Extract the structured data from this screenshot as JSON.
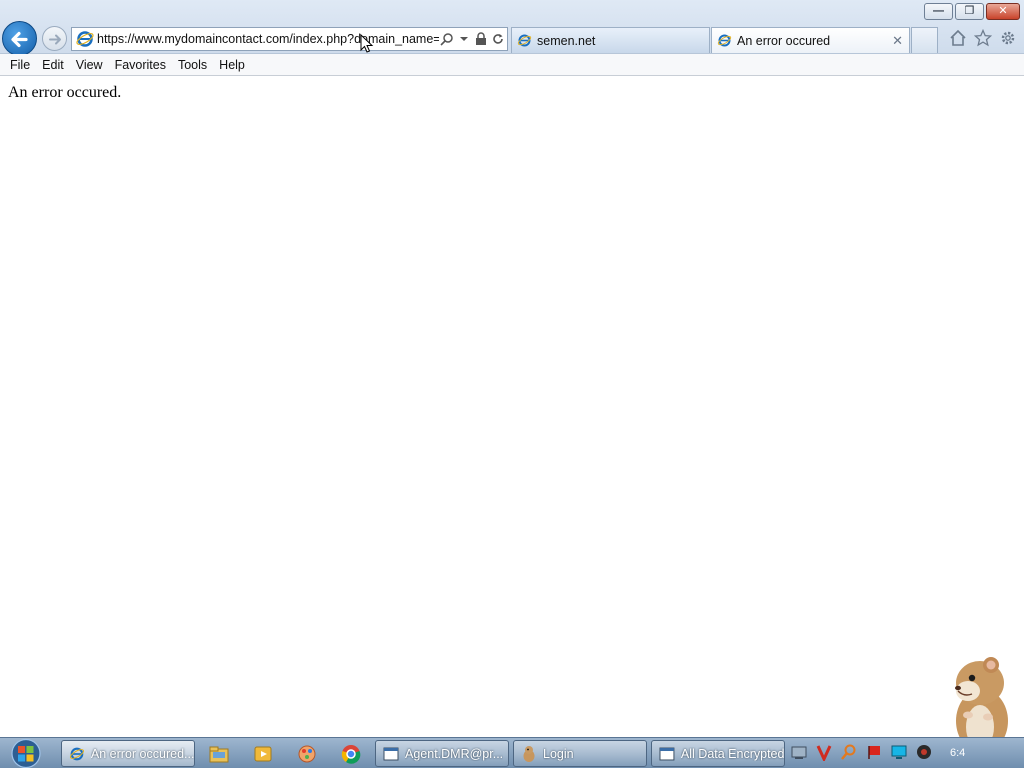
{
  "window": {
    "minimize_glyph": "—",
    "restore_glyph": "❐",
    "close_glyph": "✕"
  },
  "address_bar": {
    "url": "https://www.mydomaincontact.com/index.php?domain_name="
  },
  "tabs": [
    {
      "label": "semen.net",
      "icon": "ie-icon",
      "active": false
    },
    {
      "label": "An error occured",
      "icon": "ie-icon",
      "active": true,
      "close_glyph": "✕"
    }
  ],
  "menu": {
    "items": [
      "File",
      "Edit",
      "View",
      "Favorites",
      "Tools",
      "Help"
    ]
  },
  "page": {
    "message": "An error occured."
  },
  "taskbar": {
    "buttons": [
      {
        "label": "An error occured...",
        "icon": "ie-icon"
      },
      {
        "label": "Agent.DMR@pr...",
        "icon": "window-icon"
      },
      {
        "label": "Login",
        "icon": "hamster-icon"
      },
      {
        "label": "All Data Encrypted",
        "icon": "window-icon"
      }
    ],
    "pinned": [
      "explorer-icon",
      "media-player-icon",
      "paint-icon",
      "chrome-icon"
    ],
    "tray": [
      "network-icon",
      "v-icon",
      "search-tray-icon",
      "flag-icon",
      "monitor-icon",
      "speaker-icon"
    ],
    "clock": "6:4"
  },
  "colors": {
    "ie_blue": "#1a6fc0",
    "taskbar": "#7f9dbd",
    "tab_active": "#ffffff"
  }
}
